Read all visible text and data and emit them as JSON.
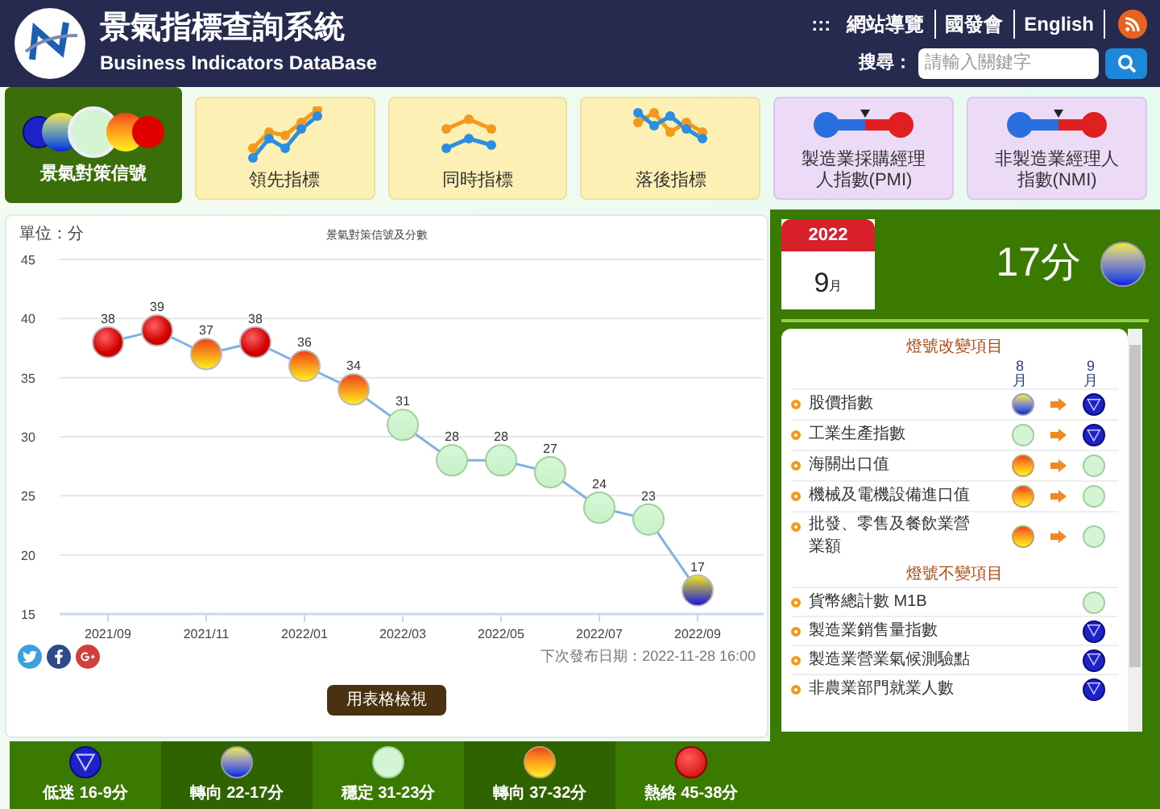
{
  "header": {
    "title": "景氣指標查詢系統",
    "subtitle": "Business Indicators DataBase",
    "accesskey": ":::",
    "links": [
      "網站導覽",
      "國發會",
      "English"
    ],
    "search": {
      "label": "搜尋：",
      "placeholder": "請輸入關鍵字"
    }
  },
  "nav": [
    {
      "kind": "signals",
      "label": "景氣對策信號",
      "selected": true
    },
    {
      "kind": "leading",
      "label": "領先指標",
      "selected": false
    },
    {
      "kind": "coincident",
      "label": "同時指標",
      "selected": false
    },
    {
      "kind": "lagging",
      "label": "落後指標",
      "selected": false
    },
    {
      "kind": "pmi",
      "label": "製造業採購經理人指數(PMI)",
      "selected": false
    },
    {
      "kind": "nmi",
      "label": "非製造業經理人指數(NMI)",
      "selected": false
    }
  ],
  "chart": {
    "chart_data": {
      "type": "line",
      "title": "景氣對策信號及分數",
      "ylabel": "單位：分",
      "ylim": [
        15,
        45
      ],
      "yticks": [
        15,
        20,
        25,
        30,
        35,
        40,
        45
      ],
      "categories": [
        "2021/09",
        null,
        "2021/11",
        null,
        "2022/01",
        null,
        "2022/03",
        null,
        "2022/05",
        null,
        "2022/07",
        null,
        "2022/09"
      ],
      "data_labels": true,
      "grid": true,
      "series": [
        {
          "color": "#7fb2e5",
          "marker": "circle",
          "values": [
            38,
            39,
            37,
            38,
            36,
            34,
            31,
            28,
            28,
            27,
            24,
            23,
            17
          ]
        }
      ]
    },
    "markers": [
      {
        "kind": "hot"
      },
      {
        "kind": "hot"
      },
      {
        "kind": "turning_high"
      },
      {
        "kind": "hot"
      },
      {
        "kind": "turning_high"
      },
      {
        "kind": "turning_high"
      },
      {
        "kind": "stable"
      },
      {
        "kind": "stable"
      },
      {
        "kind": "stable"
      },
      {
        "kind": "stable"
      },
      {
        "kind": "stable"
      },
      {
        "kind": "stable"
      },
      {
        "kind": "turning_low"
      }
    ]
  },
  "next_release": "下次發布日期：2022-11-28 16:00",
  "table_button": "用表格檢視",
  "legend": [
    {
      "kind": "low",
      "label": "低迷 16-9分"
    },
    {
      "kind": "turning_low",
      "label": "轉向 22-17分"
    },
    {
      "kind": "stable",
      "label": "穩定 31-23分"
    },
    {
      "kind": "turning_high",
      "label": "轉向 37-32分"
    },
    {
      "kind": "hot",
      "label": "熱絡 45-38分"
    }
  ],
  "current": {
    "year": "2022",
    "month": "9",
    "month_unit": "月",
    "score": "17分",
    "light": {
      "kind": "turning_low"
    }
  },
  "components": {
    "changed": {
      "title": "燈號改變項目",
      "columns": [
        {
          "number": "8",
          "unit": "月"
        },
        {
          "number": "9",
          "unit": "月"
        }
      ],
      "rows": [
        {
          "name": "股價指數",
          "from": {
            "kind": "turning_low"
          },
          "to": {
            "kind": "low"
          }
        },
        {
          "name": "工業生產指數",
          "from": {
            "kind": "stable"
          },
          "to": {
            "kind": "low"
          }
        },
        {
          "name": "海關出口值",
          "from": {
            "kind": "turning_high"
          },
          "to": {
            "kind": "stable"
          }
        },
        {
          "name": "機械及電機設備進口值",
          "from": {
            "kind": "turning_high"
          },
          "to": {
            "kind": "stable"
          }
        },
        {
          "name": "批發、零售及餐飲業營業額",
          "from": {
            "kind": "turning_high"
          },
          "to": {
            "kind": "stable"
          }
        }
      ]
    },
    "unchanged": {
      "title": "燈號不變項目",
      "rows": [
        {
          "name": "貨幣總計數 M1B",
          "kind": "stable"
        },
        {
          "name": "製造業銷售量指數",
          "kind": "low"
        },
        {
          "name": "製造業營業氣候測驗點",
          "kind": "low"
        },
        {
          "name": "非農業部門就業人數",
          "kind": "low"
        }
      ]
    }
  }
}
